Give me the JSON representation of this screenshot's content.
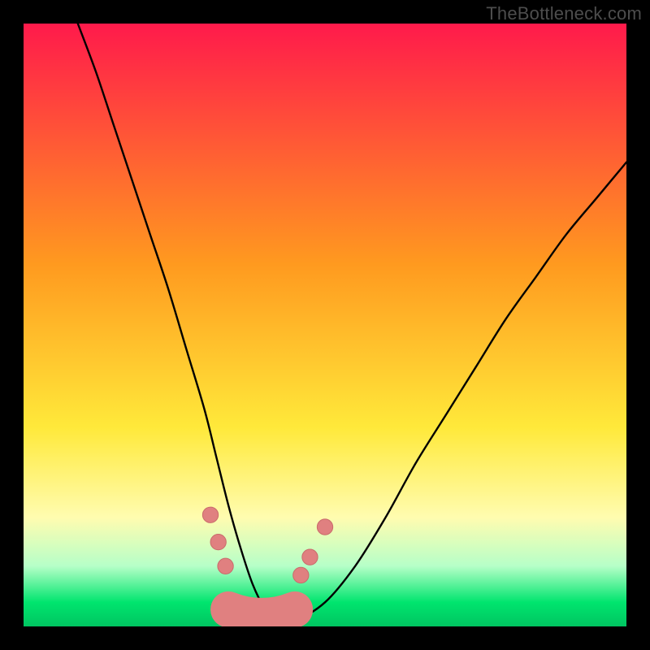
{
  "watermark": {
    "text": "TheBottleneck.com"
  },
  "colors": {
    "red_top": "#ff1a4b",
    "orange": "#ff9a1f",
    "yellow": "#ffe93a",
    "pale_yellow": "#fffcb0",
    "mint": "#b6ffc8",
    "green_deep": "#00e56e",
    "green_bottom": "#00c561",
    "curve_stroke": "#000000",
    "dot_fill": "#e08080",
    "dot_stroke": "#c96b6b"
  },
  "chart_data": {
    "type": "line",
    "title": "",
    "xlabel": "",
    "ylabel": "",
    "xlim": [
      0,
      100
    ],
    "ylim": [
      0,
      100
    ],
    "legend": false,
    "grid": false,
    "axes_visible": false,
    "series": [
      {
        "name": "bottleneck-curve",
        "x": [
          9,
          12,
          15,
          18,
          21,
          24,
          27,
          30,
          32,
          34,
          36,
          38,
          40,
          42,
          45,
          50,
          55,
          60,
          65,
          70,
          75,
          80,
          85,
          90,
          95,
          100
        ],
        "values": [
          100,
          92,
          83,
          74,
          65,
          56,
          46,
          36,
          28,
          20,
          13,
          7,
          3,
          1,
          1,
          4,
          10,
          18,
          27,
          35,
          43,
          51,
          58,
          65,
          71,
          77
        ]
      }
    ],
    "markers": [
      {
        "name": "dot-left-upper",
        "x": 31.0,
        "y": 18.5,
        "r": 1.3
      },
      {
        "name": "dot-left-mid",
        "x": 32.3,
        "y": 14.0,
        "r": 1.3
      },
      {
        "name": "dot-left-lower",
        "x": 33.5,
        "y": 10.0,
        "r": 1.3
      },
      {
        "name": "dot-right-lower",
        "x": 46.0,
        "y": 8.5,
        "r": 1.3
      },
      {
        "name": "dot-right-mid",
        "x": 47.5,
        "y": 11.5,
        "r": 1.3
      },
      {
        "name": "dot-right-upper",
        "x": 50.0,
        "y": 16.5,
        "r": 1.3
      }
    ],
    "basin": {
      "x_start": 34.0,
      "x_end": 45.0,
      "y": 2.0,
      "thickness": 3.0
    },
    "gradient_stops": [
      {
        "offset": 0.0,
        "color_key": "red_top"
      },
      {
        "offset": 0.4,
        "color_key": "orange"
      },
      {
        "offset": 0.67,
        "color_key": "yellow"
      },
      {
        "offset": 0.82,
        "color_key": "pale_yellow"
      },
      {
        "offset": 0.9,
        "color_key": "mint"
      },
      {
        "offset": 0.96,
        "color_key": "green_deep"
      },
      {
        "offset": 1.0,
        "color_key": "green_bottom"
      }
    ],
    "notes": "Ticks and axis labels are not rendered in the source image; numeric values are visual estimates on a 0–100 normalized domain."
  }
}
